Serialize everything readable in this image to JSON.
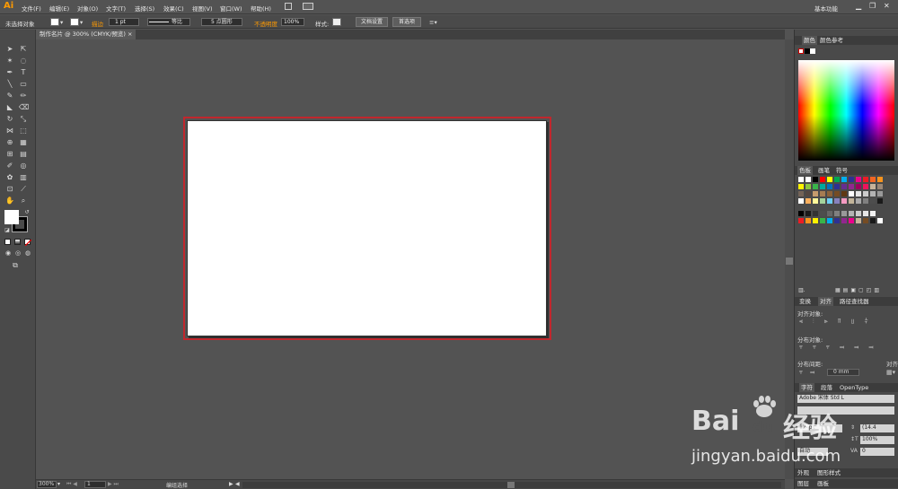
{
  "app": {
    "logo": "Ai",
    "menus": [
      "文件(F)",
      "编辑(E)",
      "对象(O)",
      "文字(T)",
      "选择(S)",
      "效果(C)",
      "视图(V)",
      "窗口(W)",
      "帮助(H)"
    ],
    "workspace": "基本功能",
    "brand_color": "#ff9a00"
  },
  "controlbar": {
    "selection_status": "未选择对象",
    "stroke_label": "描边",
    "stroke_weight": "1 pt",
    "stroke_profile": "等比",
    "brush": "5 点圆形",
    "opacity_label": "不透明度",
    "opacity_value": "100%",
    "style_label": "样式:",
    "doc_setup_button": "文档设置",
    "preferences_button": "首选项"
  },
  "document": {
    "tab_title": "制作名片 @ 300% (CMYK/预览)",
    "artboard_bleed_color": "#c1272d"
  },
  "statusbar": {
    "zoom": "300%",
    "artboard_number": "1",
    "status_text": "编组选择"
  },
  "panels": {
    "color_tabs": [
      "颜色",
      "颜色参考"
    ],
    "swatch_tabs": [
      "色板",
      "画笔",
      "符号"
    ],
    "align_tabs": [
      "变换",
      "对齐",
      "路径查找器"
    ],
    "align_objects_label": "对齐对象:",
    "distribute_objects_label": "分布对象:",
    "distribute_spacing_label": "分布间距:",
    "align_to_label": "对齐",
    "spacing_value": "0 mm",
    "char_tabs": [
      "字符",
      "段落",
      "OpenType"
    ],
    "font_family": "Adobe 宋体 Std L",
    "font_size": "12 pt",
    "leading": "(14.4",
    "scale": "100%",
    "tracking": "0",
    "kerning_mode": "自动",
    "bottom_tabs_1": [
      "外观",
      "图形样式"
    ],
    "bottom_tabs_2": [
      "图层",
      "画板"
    ]
  },
  "watermark": {
    "brand": "Bai",
    "brand_cn": "经验",
    "brand_du": "du",
    "url": "jingyan.baidu.com"
  }
}
